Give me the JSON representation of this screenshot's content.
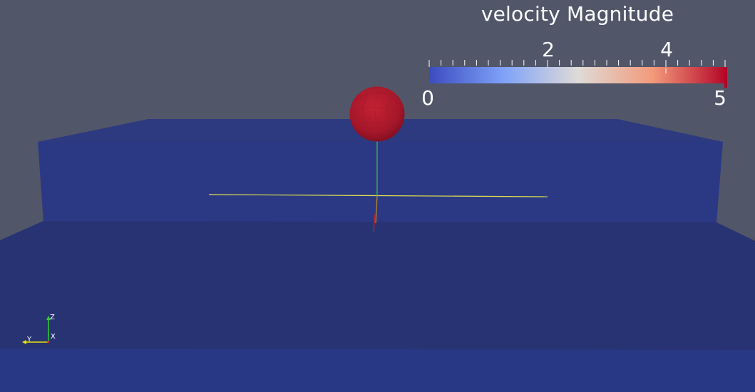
{
  "viewport": {
    "background_color": "#525669",
    "object_color": "#27347a",
    "sphere_color": "#b0192a"
  },
  "scalar_bar": {
    "title": "velocity Magnitude",
    "tick_labels": {
      "t0": "0",
      "t2": "2",
      "t4": "4",
      "t5": "5"
    },
    "range": [
      0,
      5
    ],
    "colormap": [
      "#3b4cc0",
      "#8db0fe",
      "#dddddd",
      "#f49a7b",
      "#b40426"
    ]
  },
  "orientation_axes": {
    "z_label": "Z",
    "x_label": "X",
    "y_label": "Y",
    "z_color": "#33cc33",
    "y_color": "#e8e800",
    "x_color": "#cc2222"
  },
  "widget": {
    "icon": "center-axes-icon"
  }
}
